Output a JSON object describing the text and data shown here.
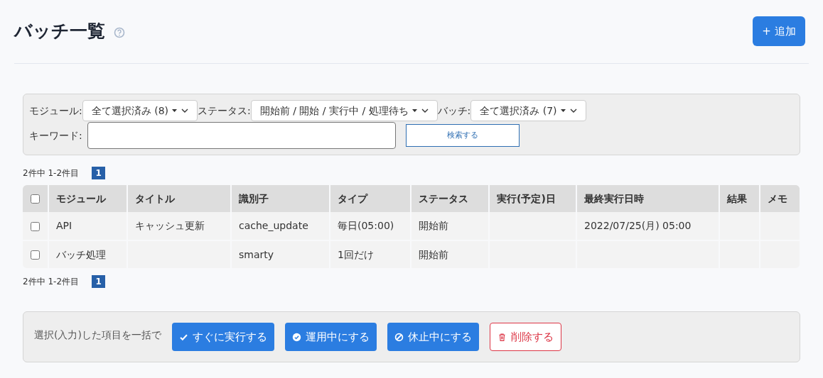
{
  "header": {
    "title": "バッチ一覧",
    "add_button": "+ 追加"
  },
  "filters": {
    "module": {
      "label": "モジュール:",
      "value": "全て選択済み (8)"
    },
    "status": {
      "label": "ステータス:",
      "value": "開始前 / 開始 / 実行中 / 処理待ち"
    },
    "batch": {
      "label": "バッチ:",
      "value": "全て選択済み (7)"
    },
    "keyword": {
      "label": "キーワード:"
    },
    "search_button": "検索する"
  },
  "pager_top": {
    "summary": "2件中 1-2件目",
    "pages": [
      {
        "label": "1",
        "selected": true
      }
    ]
  },
  "table": {
    "select_all": {
      "checked": false
    },
    "columns": [
      "モジュール",
      "タイトル",
      "識別子",
      "タイプ",
      "ステータス",
      "実行(予定)日",
      "最終実行日時",
      "結果",
      "メモ"
    ],
    "rows": [
      {
        "checked": false,
        "cells": [
          "API",
          "キャッシュ更新",
          "cache_update",
          "毎日(05:00)",
          "開始前",
          "",
          "2022/07/25(月) 05:00",
          "",
          ""
        ]
      },
      {
        "checked": false,
        "cells": [
          "バッチ処理",
          "",
          "smarty",
          "1回だけ",
          "開始前",
          "",
          "",
          "",
          ""
        ]
      }
    ]
  },
  "pager_bottom": {
    "summary": "2件中 1-2件目",
    "pages": [
      {
        "label": "1",
        "selected": true
      }
    ]
  },
  "bulk": {
    "label": "選択(入力)した項目を一括で",
    "buttons": [
      {
        "kind": "run",
        "label": "すぐに実行する"
      },
      {
        "kind": "enable",
        "label": "運用中にする"
      },
      {
        "kind": "disable",
        "label": "休止中にする"
      },
      {
        "kind": "delete",
        "label": "削除する"
      }
    ]
  }
}
